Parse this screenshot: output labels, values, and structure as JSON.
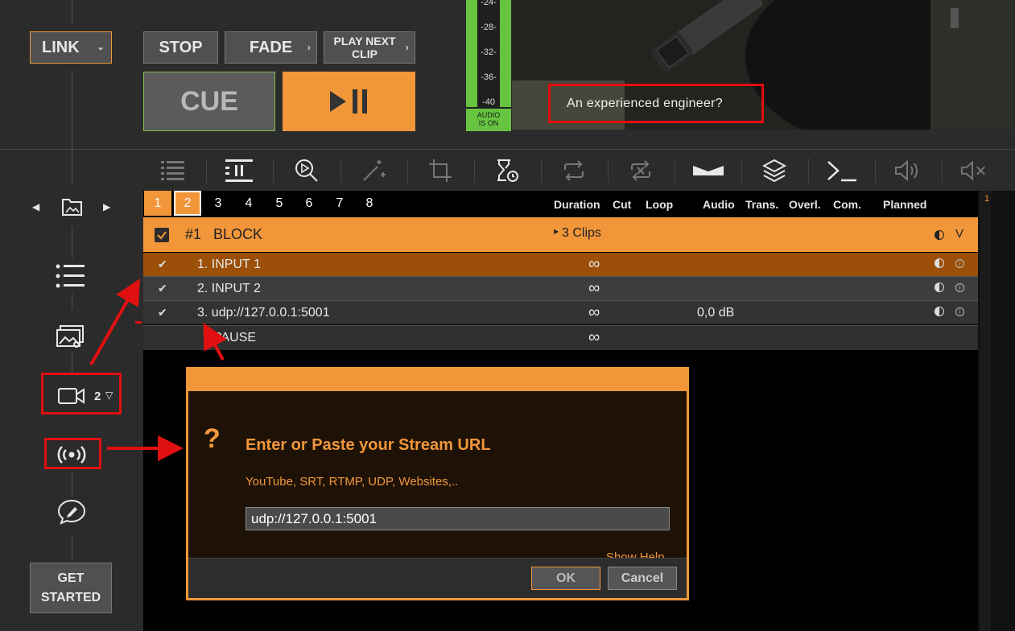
{
  "top": {
    "link_label": "LINK",
    "stop_label": "STOP",
    "fade_label": "FADE",
    "play_next_label_line1": "PLAY NEXT",
    "play_next_label_line2": "CLIP",
    "cue_label": "CUE",
    "play_pause_icon": "play-pause-icon"
  },
  "meter": {
    "ticks": [
      "-24-",
      "-28-",
      "-32-",
      "-36-",
      "-40"
    ],
    "audio_on_line1": "AUDIO",
    "audio_on_line2": "IS ON"
  },
  "preview": {
    "caption": "An experienced engineer?"
  },
  "sidebar": {
    "camera_count": "2",
    "get_started_line1": "GET",
    "get_started_line2": "STARTED"
  },
  "tabs": [
    "1",
    "2",
    "3",
    "4",
    "5",
    "6",
    "7",
    "8"
  ],
  "columns": {
    "duration": "Duration",
    "cut": "Cut",
    "loop": "Loop",
    "audio": "Audio",
    "trans": "Trans.",
    "overl": "Overl.",
    "com": "Com.",
    "planned": "Planned"
  },
  "block": {
    "number": "#1",
    "name": "BLOCK",
    "clips": "3 Clips",
    "collapse": "V"
  },
  "rows": [
    {
      "index": "1.",
      "name": "INPUT 1",
      "duration": "∞",
      "audio": ""
    },
    {
      "index": "2.",
      "name": "INPUT 2",
      "duration": "∞",
      "audio": ""
    },
    {
      "index": "3.",
      "name": "udp://127.0.0.1:5001",
      "duration": "∞",
      "audio": "0,0 dB"
    }
  ],
  "pause_row": {
    "name": "PAUSE",
    "duration": "∞"
  },
  "right_ruler": "1",
  "dialog": {
    "icon": "?",
    "heading": "Enter or Paste your Stream URL",
    "subtitle": "YouTube, SRT, RTMP, UDP, Websites,..",
    "url_value": "udp://127.0.0.1:5001",
    "help_link": "Show Help",
    "ok_label": "OK",
    "cancel_label": "Cancel"
  },
  "colors": {
    "accent": "#f2963a",
    "highlight_red": "#e01010",
    "meter_green": "#66c441",
    "selected_row": "#9c4f08"
  }
}
